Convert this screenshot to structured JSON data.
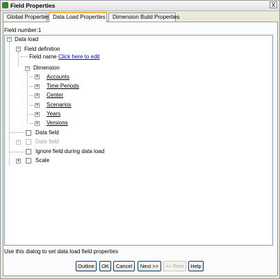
{
  "window": {
    "title": "Field Properties",
    "close_label": "X"
  },
  "tabs": [
    {
      "label": "Global Properties",
      "active": false
    },
    {
      "label": "Data Load Properties",
      "active": true
    },
    {
      "label": "Dimension Build Properties",
      "active": false
    }
  ],
  "field_number": "Field number:1",
  "tree": {
    "data_load": "Data load",
    "field_definition": "Field definition",
    "field_name_label": "Field name",
    "field_name_link": "Click here to edit",
    "dimension": "Dimension",
    "dimensions": [
      "Accounts",
      "Time Periods",
      "Center",
      "Scenarios",
      "Years",
      "Versions"
    ],
    "data_field": "Data field",
    "date_field": "Date field",
    "ignore_field": "Ignore field during data load",
    "scale": "Scale"
  },
  "hint": "Use this dialog to set data load field properties",
  "buttons": {
    "outline": "Outline",
    "ok": "OK",
    "cancel": "Cancel",
    "next": "Next >>",
    "prev": "<< Prev",
    "help": "Help"
  },
  "icons": {
    "app": "field-properties-app-icon",
    "expand": "plus-icon",
    "collapse": "minus-icon"
  }
}
